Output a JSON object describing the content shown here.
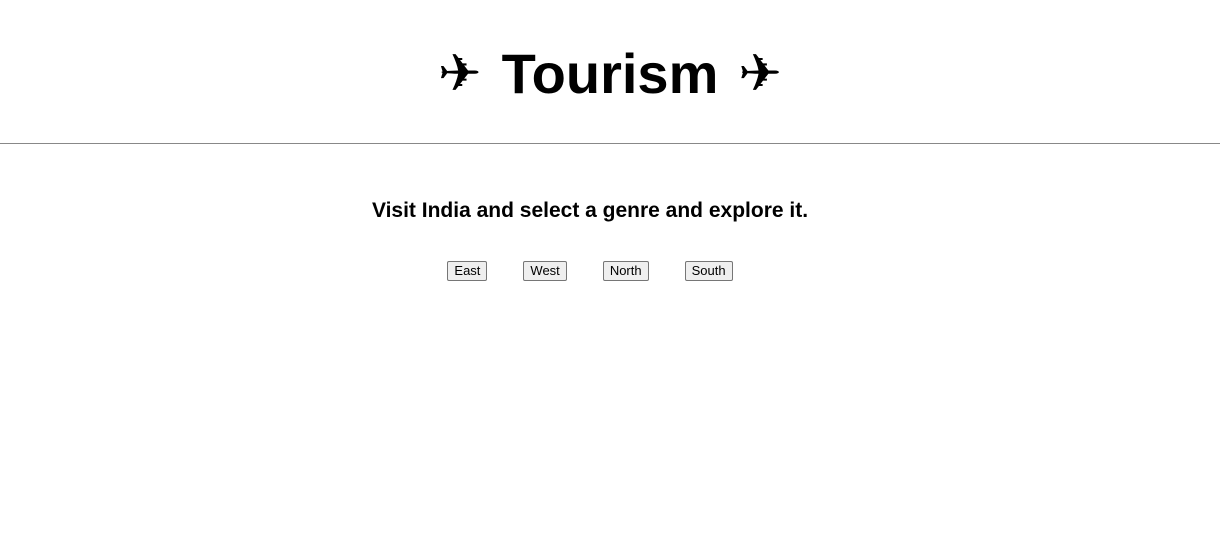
{
  "header": {
    "title": "Tourism",
    "icon_left": "✈",
    "icon_right": "✈",
    "icon_name": "airplane-icon"
  },
  "main": {
    "subtitle": "Visit India and select a genre and explore it.",
    "buttons": [
      {
        "label": "East"
      },
      {
        "label": "West"
      },
      {
        "label": "North"
      },
      {
        "label": "South"
      }
    ]
  },
  "colors": {
    "background": "#ffffff",
    "text": "#000000",
    "divider": "#888888",
    "button_bg": "#efefef",
    "button_border": "#767676"
  }
}
